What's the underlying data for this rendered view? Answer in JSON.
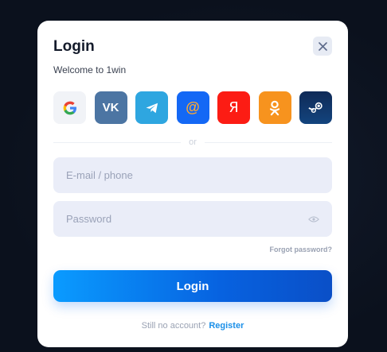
{
  "modal": {
    "title": "Login",
    "subtitle": "Welcome to 1win",
    "close_icon": "close-icon"
  },
  "socials": [
    {
      "name": "google",
      "icon": "google-icon",
      "bg": "#f1f3f7"
    },
    {
      "name": "vk",
      "icon": "vk-icon",
      "bg": "#4c75a3",
      "glyph": "VK"
    },
    {
      "name": "telegram",
      "icon": "telegram-icon",
      "bg": "#2ea6e0"
    },
    {
      "name": "mail",
      "icon": "mail-at-icon",
      "bg": "#1468f5",
      "glyph": "@"
    },
    {
      "name": "yandex",
      "icon": "yandex-icon",
      "bg": "#fc1c14",
      "glyph": "Я"
    },
    {
      "name": "odnoklassniki",
      "icon": "ok-icon",
      "bg": "#f7931e"
    },
    {
      "name": "steam",
      "icon": "steam-icon",
      "bg": "#0f2a57"
    }
  ],
  "divider": {
    "text": "or"
  },
  "email": {
    "value": "",
    "placeholder": "E-mail / phone"
  },
  "password": {
    "value": "",
    "placeholder": "Password",
    "icon": "eye-icon"
  },
  "forgot_label": "Forgot password?",
  "login_label": "Login",
  "footer": {
    "prompt": "Still no account?",
    "register_label": "Register"
  },
  "colors": {
    "accent": "#0a7cf0",
    "link": "#1a8fe8",
    "backdrop": "#0c1322"
  }
}
